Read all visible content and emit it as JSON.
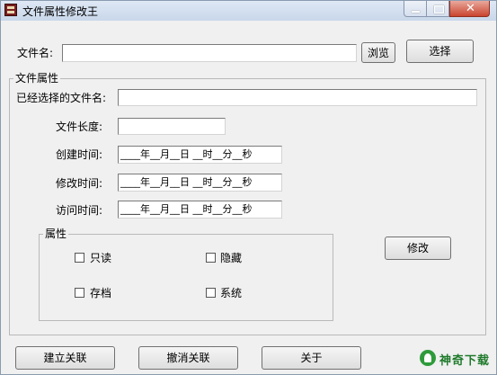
{
  "window": {
    "title": "文件属性修改王"
  },
  "file_row": {
    "label": "文件名:",
    "value": "",
    "browse_label": "浏览",
    "select_label": "选择"
  },
  "properties_group": {
    "title": "文件属性",
    "selected_file_label": "已经选择的文件名:",
    "selected_file_value": "",
    "file_length_label": "文件长度:",
    "file_length_value": "",
    "created_label": "创建时间:",
    "modified_label": "修改时间:",
    "accessed_label": "访问时间:",
    "date_template": "____年__月__日 __时__分__秒",
    "modify_button": "修改"
  },
  "attributes_group": {
    "title": "属性",
    "readonly_label": "只读",
    "hidden_label": "隐藏",
    "archive_label": "存档",
    "system_label": "系统",
    "readonly_checked": false,
    "hidden_checked": false,
    "archive_checked": false,
    "system_checked": false
  },
  "bottom_buttons": {
    "associate": "建立关联",
    "unassociate": "撤消关联",
    "about": "关于"
  },
  "watermark": {
    "text": "神奇下载"
  },
  "icons": {
    "app": "app-icon",
    "minimize": "minimize-icon",
    "maximize": "maximize-icon",
    "close": "close-icon",
    "watermark": "leaf-logo-icon"
  },
  "colors": {
    "window_bg": "#f0f0f0",
    "titlebar": "#c9d7ea",
    "close_button": "#c9442f",
    "watermark": "#1f7a2b"
  }
}
